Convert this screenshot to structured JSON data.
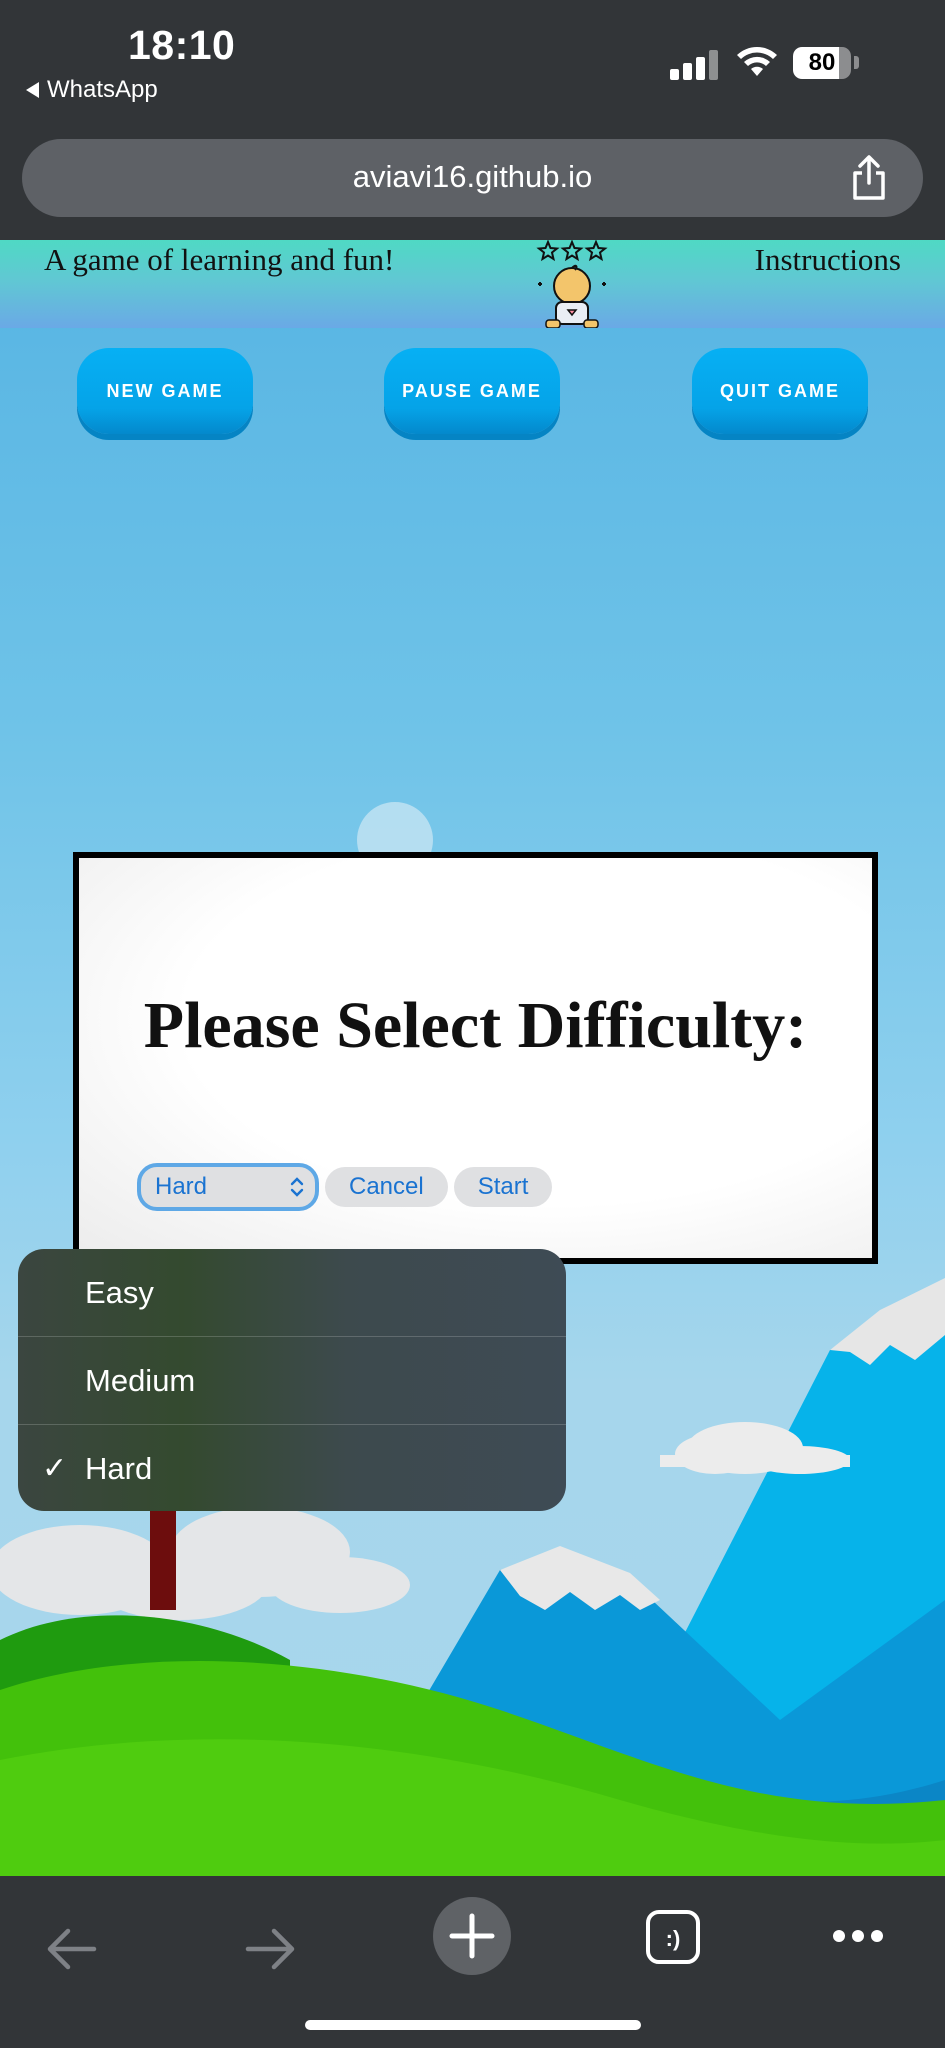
{
  "status_bar": {
    "time": "18:10",
    "back_app": "WhatsApp",
    "battery": "80"
  },
  "browser": {
    "url": "aviavi16.github.io"
  },
  "header": {
    "tagline": "A game of learning and fun!",
    "instructions_link": "Instructions"
  },
  "game_buttons": {
    "new_game": "NEW GAME",
    "pause_game": "PAUSE GAME",
    "quit_game": "QUIT GAME"
  },
  "modal": {
    "title": "Please Select Difficulty:",
    "selected_difficulty": "Hard",
    "cancel_label": "Cancel",
    "start_label": "Start"
  },
  "difficulty_options": [
    "Easy",
    "Medium",
    "Hard"
  ],
  "colors": {
    "chrome": "#323538",
    "button_blue": "#05a3e8",
    "link_blue": "#1a73d1"
  }
}
